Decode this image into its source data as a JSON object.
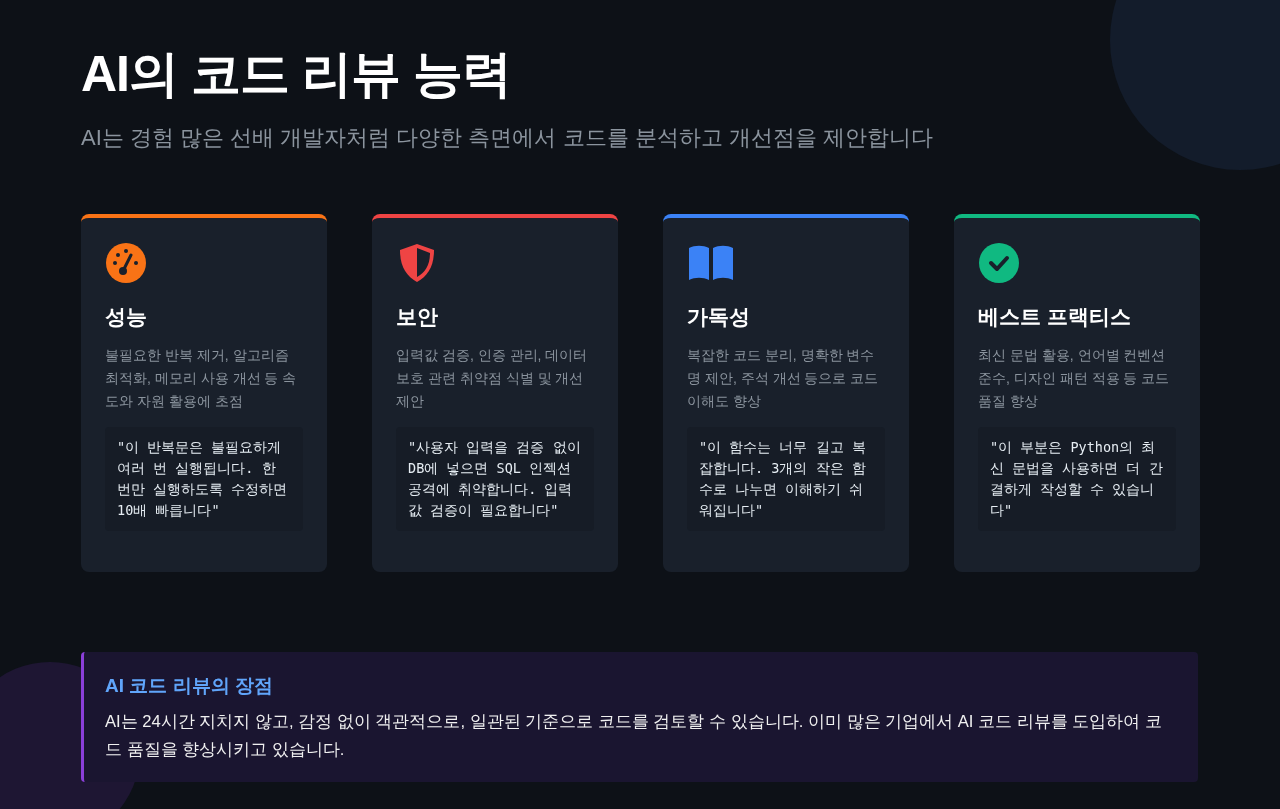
{
  "title": "AI의 코드 리뷰 능력",
  "subtitle": "AI는 경험 많은 선배 개발자처럼 다양한 측면에서 코드를 분석하고 개선점을 제안합니다",
  "cards": [
    {
      "kind": "gauge",
      "color": "#f97316",
      "title": "성능",
      "description": "불필요한 반복 제거, 알고리즘 최적화, 메모리 사용 개선 등 속도와 자원 활용에 초점",
      "example": "\"이 반복문은 불필요하게 여러 번 실행됩니다. 한 번만 실행하도록 수정하면 10배 빠릅니다\""
    },
    {
      "kind": "shield",
      "color": "#ef4444",
      "title": "보안",
      "description": "입력값 검증, 인증 관리, 데이터 보호 관련 취약점 식별 및 개선 제안",
      "example": "\"사용자 입력을 검증 없이 DB에 넣으면 SQL 인젝션 공격에 취약합니다. 입력값 검증이 필요합니다\""
    },
    {
      "kind": "book",
      "color": "#3b82f6",
      "title": "가독성",
      "description": "복잡한 코드 분리, 명확한 변수명 제안, 주석 개선 등으로 코드 이해도 향상",
      "example": "\"이 함수는 너무 길고 복잡합니다. 3개의 작은 함수로 나누면 이해하기 쉬워집니다\""
    },
    {
      "kind": "check",
      "color": "#10b981",
      "title": "베스트 프랙티스",
      "description": "최신 문법 활용, 언어별 컨벤션 준수, 디자인 패턴 적용 등 코드 품질 향상",
      "example": "\"이 부분은 Python의 최신 문법을 사용하면 더 간결하게 작성할 수 있습니다\""
    }
  ],
  "callout": {
    "heading": "AI 코드 리뷰의 장점",
    "text": "AI는 24시간 지치지 않고, 감정 없이 객관적으로, 일관된 기준으로 코드를 검토할 수 있습니다. 이미 많은 기업에서 AI 코드 리뷰를 도입하여 코드 품질을 향상시키고 있습니다."
  }
}
